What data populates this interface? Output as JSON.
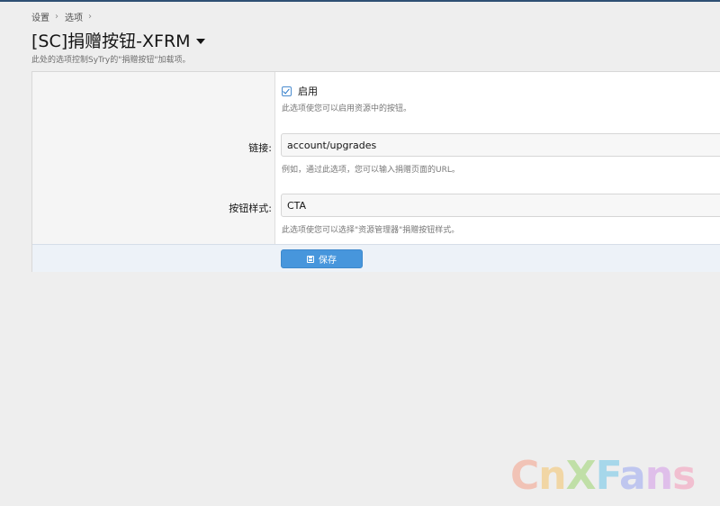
{
  "breadcrumb": {
    "items": [
      "设置",
      "选项"
    ]
  },
  "header": {
    "title": "[SC]捐赠按钮-XFRM",
    "description": "此处的选项控制SyTry的\"捐赠按钮\"加载项。"
  },
  "form": {
    "enable": {
      "checked": true,
      "label": "启用",
      "hint": "此选项使您可以启用资源中的按钮。"
    },
    "link": {
      "label": "链接:",
      "value": "account/upgrades",
      "hint": "例如，通过此选项，您可以输入捐赠页面的URL。"
    },
    "button_style": {
      "label": "按钮样式:",
      "value": "CTA",
      "hint": "此选项使您可以选择\"资源管理器\"捐赠按钮样式。"
    },
    "save_label": "保存"
  },
  "watermark": {
    "letters": [
      "C",
      "n",
      "X",
      "F",
      "a",
      "n",
      "s"
    ]
  },
  "colors": {
    "accent": "#4796dc",
    "footer_bg": "#edf2f8",
    "page_bg": "#eeeeee"
  }
}
